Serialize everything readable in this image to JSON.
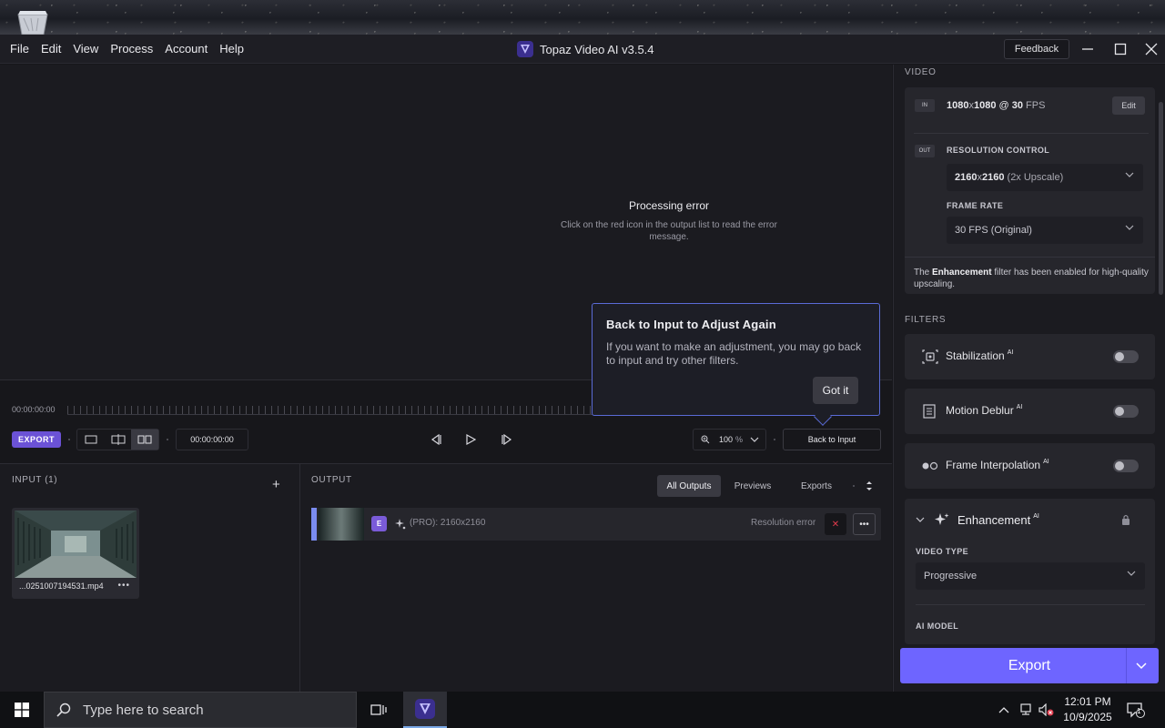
{
  "window": {
    "title": "Topaz Video AI  v3.5.4",
    "feedback_label": "Feedback"
  },
  "menu": [
    "File",
    "Edit",
    "View",
    "Process",
    "Account",
    "Help"
  ],
  "preview": {
    "error_title": "Processing error",
    "error_desc": "Click on the red icon in the output list to read the error message."
  },
  "timeline": {
    "timecode": "00:00:00:00",
    "export_badge": "EXPORT",
    "current_time": "00:00:00:00",
    "zoom": "100",
    "zoom_unit": "%",
    "back_label": "Back to Input"
  },
  "tooltip": {
    "title": "Back to Input to Adjust Again",
    "body": "If you want to make an adjustment, you may go back to input and try other filters.",
    "button": "Got it"
  },
  "input": {
    "header": "INPUT (1)",
    "add_icon": "+",
    "file_name": "...0251007194531.mp4",
    "more": "•••"
  },
  "output": {
    "header": "OUTPUT",
    "tabs": [
      "All Outputs",
      "Previews",
      "Exports"
    ],
    "row": {
      "badge": "E",
      "label": "(PRO): 2160x2160",
      "status": "Resolution error",
      "close": "✕",
      "more": "•••"
    }
  },
  "video": {
    "header": "VIDEO",
    "in_tag": "IN",
    "in_w": "1080",
    "in_x": "x",
    "in_h": "1080",
    "in_at": " @ ",
    "in_fps": "30",
    "in_fps_unit": " FPS",
    "edit_label": "Edit",
    "out_tag": "OUT",
    "res_label": "RESOLUTION CONTROL",
    "res_value_bold": "2160",
    "res_value_x": "x",
    "res_value_bold2": "2160",
    "res_value_rest": " (2x Upscale)",
    "fr_label": "FRAME RATE",
    "fr_value": "30 FPS (Original)",
    "note_pre": "The ",
    "note_bold": "Enhancement",
    "note_post": " filter has been enabled for high-quality upscaling."
  },
  "filters": {
    "header": "FILTERS",
    "items": [
      {
        "name": "Stabilization",
        "sup": "AI",
        "icon": "stabilization-icon",
        "enabled": false
      },
      {
        "name": "Motion Deblur",
        "sup": "AI",
        "icon": "motion-deblur-icon",
        "enabled": false
      },
      {
        "name": "Frame Interpolation",
        "sup": "AI",
        "icon": "frame-interpolation-icon",
        "enabled": false
      }
    ],
    "enhancement": {
      "name": "Enhancement",
      "sup": "AI",
      "video_type_label": "VIDEO TYPE",
      "video_type_value": "Progressive",
      "ai_model_label": "AI MODEL"
    }
  },
  "export_button": "Export",
  "taskbar": {
    "search_placeholder": "Type here to search",
    "time": "12:01 PM",
    "date": "10/9/2025",
    "notification_count": "1"
  },
  "colors": {
    "accent": "#6e65ff",
    "export_badge": "#6b52d6",
    "tooltip_border": "#5a6bd6",
    "error_x": "#e03a4c"
  }
}
